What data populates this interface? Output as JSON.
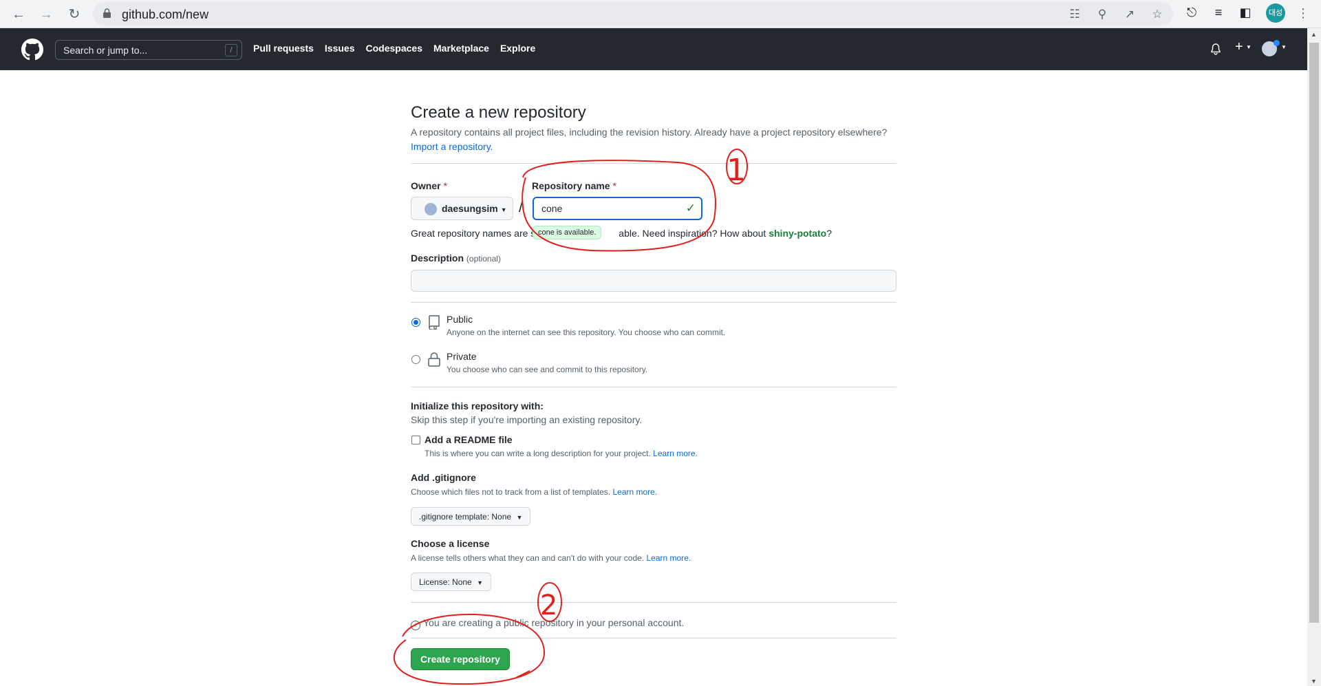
{
  "browser": {
    "url": "github.com/new",
    "profile_initials": "대성"
  },
  "header": {
    "search_placeholder": "Search or jump to...",
    "slash_key": "/",
    "nav": [
      "Pull requests",
      "Issues",
      "Codespaces",
      "Marketplace",
      "Explore"
    ]
  },
  "page": {
    "title": "Create a new repository",
    "subtitle": "A repository contains all project files, including the revision history. Already have a project repository elsewhere?",
    "import_link": "Import a repository.",
    "owner_label": "Owner",
    "required_mark": "*",
    "owner_value": "daesungsim",
    "separator": "/",
    "repo_label": "Repository name",
    "repo_value": "cone",
    "availability_tooltip": "cone is available.",
    "hint_prefix": "Great repository names are s",
    "hint_middle": "able. Need inspiration? How about ",
    "suggestion": "shiny-potato",
    "hint_suffix": "?",
    "description_label": "Description",
    "description_optional": "(optional)",
    "description_value": "",
    "visibility": [
      {
        "title": "Public",
        "desc": "Anyone on the internet can see this repository. You choose who can commit.",
        "selected": true,
        "icon": "repo-icon"
      },
      {
        "title": "Private",
        "desc": "You choose who can see and commit to this repository.",
        "selected": false,
        "icon": "lock-icon"
      }
    ],
    "init_title": "Initialize this repository with:",
    "init_sub": "Skip this step if you're importing an existing repository.",
    "readme_label": "Add a README file",
    "readme_desc": "This is where you can write a long description for your project.",
    "learn_more": "Learn more.",
    "gitignore_title": "Add .gitignore",
    "gitignore_desc": "Choose which files not to track from a list of templates.",
    "gitignore_select": ".gitignore template: None",
    "license_title": "Choose a license",
    "license_desc": "A license tells others what they can and can't do with your code.",
    "license_select": "License: None",
    "info_text": "You are creating a public repository in your personal account.",
    "create_button": "Create repository"
  },
  "annotations": [
    "1",
    "2"
  ],
  "colors": {
    "header_bg": "#24292f",
    "primary_button": "#2da44e",
    "link": "#0969da",
    "annotation": "#e0201d"
  }
}
